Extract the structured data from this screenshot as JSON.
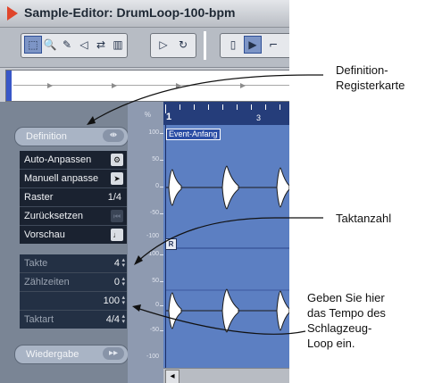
{
  "window": {
    "title": "Sample-Editor: DrumLoop-100-bpm"
  },
  "toolbar": {
    "group1_icons": [
      "range-select-icon",
      "zoom-icon",
      "pencil-icon",
      "speaker-icon",
      "warp-icon",
      "hitpoint-icon"
    ],
    "group2_icons": [
      "play-icon",
      "loop-icon"
    ],
    "group3_icons": [
      "audition-icon",
      "snap-icon",
      "marker-icon"
    ]
  },
  "panel": {
    "definition_tab": "Definition",
    "rows": [
      {
        "label": "Auto-Anpassen",
        "kind": "button"
      },
      {
        "label": "Manuell anpasse",
        "kind": "button"
      },
      {
        "label": "Raster",
        "kind": "value",
        "value": "1/4"
      },
      {
        "label": "Zurücksetzen",
        "kind": "button-dim"
      },
      {
        "label": "Vorschau",
        "kind": "button"
      }
    ],
    "values": [
      {
        "label": "Takte",
        "value": "4"
      },
      {
        "label": "Zählzeiten",
        "value": "0"
      },
      {
        "label": "",
        "value": "100"
      },
      {
        "label": "Taktart",
        "value": "4/4"
      }
    ],
    "playback_tab": "Wiedergabe"
  },
  "scale": {
    "top_label": "%",
    "labels_upper": [
      "100",
      "50",
      "0",
      "-50",
      "-100"
    ],
    "labels_lower": [
      "100",
      "50",
      "0",
      "-50",
      "-100"
    ]
  },
  "ruler": {
    "numbers": [
      "1",
      "3"
    ]
  },
  "event": {
    "start_label": "Event-Anfang",
    "range_marker": "R"
  },
  "callouts": {
    "definition": [
      "Definition-",
      "Registerkarte"
    ],
    "bars": [
      "Taktanzahl"
    ],
    "tempo": [
      "Geben Sie hier",
      "das Tempo des",
      "Schlagzeug-",
      "Loop ein."
    ]
  }
}
